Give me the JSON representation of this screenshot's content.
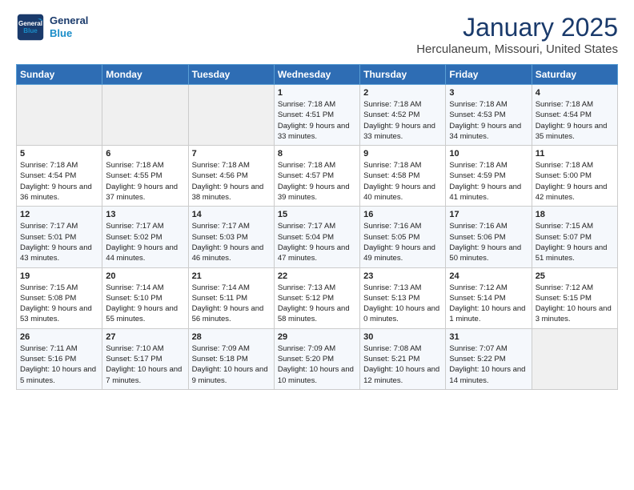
{
  "header": {
    "logo_line1": "General",
    "logo_line2": "Blue",
    "title": "January 2025",
    "subtitle": "Herculaneum, Missouri, United States"
  },
  "days_of_week": [
    "Sunday",
    "Monday",
    "Tuesday",
    "Wednesday",
    "Thursday",
    "Friday",
    "Saturday"
  ],
  "weeks": [
    [
      {
        "day": "",
        "sunrise": "",
        "sunset": "",
        "daylight": "",
        "empty": true
      },
      {
        "day": "",
        "sunrise": "",
        "sunset": "",
        "daylight": "",
        "empty": true
      },
      {
        "day": "",
        "sunrise": "",
        "sunset": "",
        "daylight": "",
        "empty": true
      },
      {
        "day": "1",
        "sunrise": "Sunrise: 7:18 AM",
        "sunset": "Sunset: 4:51 PM",
        "daylight": "Daylight: 9 hours and 33 minutes."
      },
      {
        "day": "2",
        "sunrise": "Sunrise: 7:18 AM",
        "sunset": "Sunset: 4:52 PM",
        "daylight": "Daylight: 9 hours and 33 minutes."
      },
      {
        "day": "3",
        "sunrise": "Sunrise: 7:18 AM",
        "sunset": "Sunset: 4:53 PM",
        "daylight": "Daylight: 9 hours and 34 minutes."
      },
      {
        "day": "4",
        "sunrise": "Sunrise: 7:18 AM",
        "sunset": "Sunset: 4:54 PM",
        "daylight": "Daylight: 9 hours and 35 minutes."
      }
    ],
    [
      {
        "day": "5",
        "sunrise": "Sunrise: 7:18 AM",
        "sunset": "Sunset: 4:54 PM",
        "daylight": "Daylight: 9 hours and 36 minutes."
      },
      {
        "day": "6",
        "sunrise": "Sunrise: 7:18 AM",
        "sunset": "Sunset: 4:55 PM",
        "daylight": "Daylight: 9 hours and 37 minutes."
      },
      {
        "day": "7",
        "sunrise": "Sunrise: 7:18 AM",
        "sunset": "Sunset: 4:56 PM",
        "daylight": "Daylight: 9 hours and 38 minutes."
      },
      {
        "day": "8",
        "sunrise": "Sunrise: 7:18 AM",
        "sunset": "Sunset: 4:57 PM",
        "daylight": "Daylight: 9 hours and 39 minutes."
      },
      {
        "day": "9",
        "sunrise": "Sunrise: 7:18 AM",
        "sunset": "Sunset: 4:58 PM",
        "daylight": "Daylight: 9 hours and 40 minutes."
      },
      {
        "day": "10",
        "sunrise": "Sunrise: 7:18 AM",
        "sunset": "Sunset: 4:59 PM",
        "daylight": "Daylight: 9 hours and 41 minutes."
      },
      {
        "day": "11",
        "sunrise": "Sunrise: 7:18 AM",
        "sunset": "Sunset: 5:00 PM",
        "daylight": "Daylight: 9 hours and 42 minutes."
      }
    ],
    [
      {
        "day": "12",
        "sunrise": "Sunrise: 7:17 AM",
        "sunset": "Sunset: 5:01 PM",
        "daylight": "Daylight: 9 hours and 43 minutes."
      },
      {
        "day": "13",
        "sunrise": "Sunrise: 7:17 AM",
        "sunset": "Sunset: 5:02 PM",
        "daylight": "Daylight: 9 hours and 44 minutes."
      },
      {
        "day": "14",
        "sunrise": "Sunrise: 7:17 AM",
        "sunset": "Sunset: 5:03 PM",
        "daylight": "Daylight: 9 hours and 46 minutes."
      },
      {
        "day": "15",
        "sunrise": "Sunrise: 7:17 AM",
        "sunset": "Sunset: 5:04 PM",
        "daylight": "Daylight: 9 hours and 47 minutes."
      },
      {
        "day": "16",
        "sunrise": "Sunrise: 7:16 AM",
        "sunset": "Sunset: 5:05 PM",
        "daylight": "Daylight: 9 hours and 49 minutes."
      },
      {
        "day": "17",
        "sunrise": "Sunrise: 7:16 AM",
        "sunset": "Sunset: 5:06 PM",
        "daylight": "Daylight: 9 hours and 50 minutes."
      },
      {
        "day": "18",
        "sunrise": "Sunrise: 7:15 AM",
        "sunset": "Sunset: 5:07 PM",
        "daylight": "Daylight: 9 hours and 51 minutes."
      }
    ],
    [
      {
        "day": "19",
        "sunrise": "Sunrise: 7:15 AM",
        "sunset": "Sunset: 5:08 PM",
        "daylight": "Daylight: 9 hours and 53 minutes."
      },
      {
        "day": "20",
        "sunrise": "Sunrise: 7:14 AM",
        "sunset": "Sunset: 5:10 PM",
        "daylight": "Daylight: 9 hours and 55 minutes."
      },
      {
        "day": "21",
        "sunrise": "Sunrise: 7:14 AM",
        "sunset": "Sunset: 5:11 PM",
        "daylight": "Daylight: 9 hours and 56 minutes."
      },
      {
        "day": "22",
        "sunrise": "Sunrise: 7:13 AM",
        "sunset": "Sunset: 5:12 PM",
        "daylight": "Daylight: 9 hours and 58 minutes."
      },
      {
        "day": "23",
        "sunrise": "Sunrise: 7:13 AM",
        "sunset": "Sunset: 5:13 PM",
        "daylight": "Daylight: 10 hours and 0 minutes."
      },
      {
        "day": "24",
        "sunrise": "Sunrise: 7:12 AM",
        "sunset": "Sunset: 5:14 PM",
        "daylight": "Daylight: 10 hours and 1 minute."
      },
      {
        "day": "25",
        "sunrise": "Sunrise: 7:12 AM",
        "sunset": "Sunset: 5:15 PM",
        "daylight": "Daylight: 10 hours and 3 minutes."
      }
    ],
    [
      {
        "day": "26",
        "sunrise": "Sunrise: 7:11 AM",
        "sunset": "Sunset: 5:16 PM",
        "daylight": "Daylight: 10 hours and 5 minutes."
      },
      {
        "day": "27",
        "sunrise": "Sunrise: 7:10 AM",
        "sunset": "Sunset: 5:17 PM",
        "daylight": "Daylight: 10 hours and 7 minutes."
      },
      {
        "day": "28",
        "sunrise": "Sunrise: 7:09 AM",
        "sunset": "Sunset: 5:18 PM",
        "daylight": "Daylight: 10 hours and 9 minutes."
      },
      {
        "day": "29",
        "sunrise": "Sunrise: 7:09 AM",
        "sunset": "Sunset: 5:20 PM",
        "daylight": "Daylight: 10 hours and 10 minutes."
      },
      {
        "day": "30",
        "sunrise": "Sunrise: 7:08 AM",
        "sunset": "Sunset: 5:21 PM",
        "daylight": "Daylight: 10 hours and 12 minutes."
      },
      {
        "day": "31",
        "sunrise": "Sunrise: 7:07 AM",
        "sunset": "Sunset: 5:22 PM",
        "daylight": "Daylight: 10 hours and 14 minutes."
      },
      {
        "day": "",
        "sunrise": "",
        "sunset": "",
        "daylight": "",
        "empty": true
      }
    ]
  ]
}
